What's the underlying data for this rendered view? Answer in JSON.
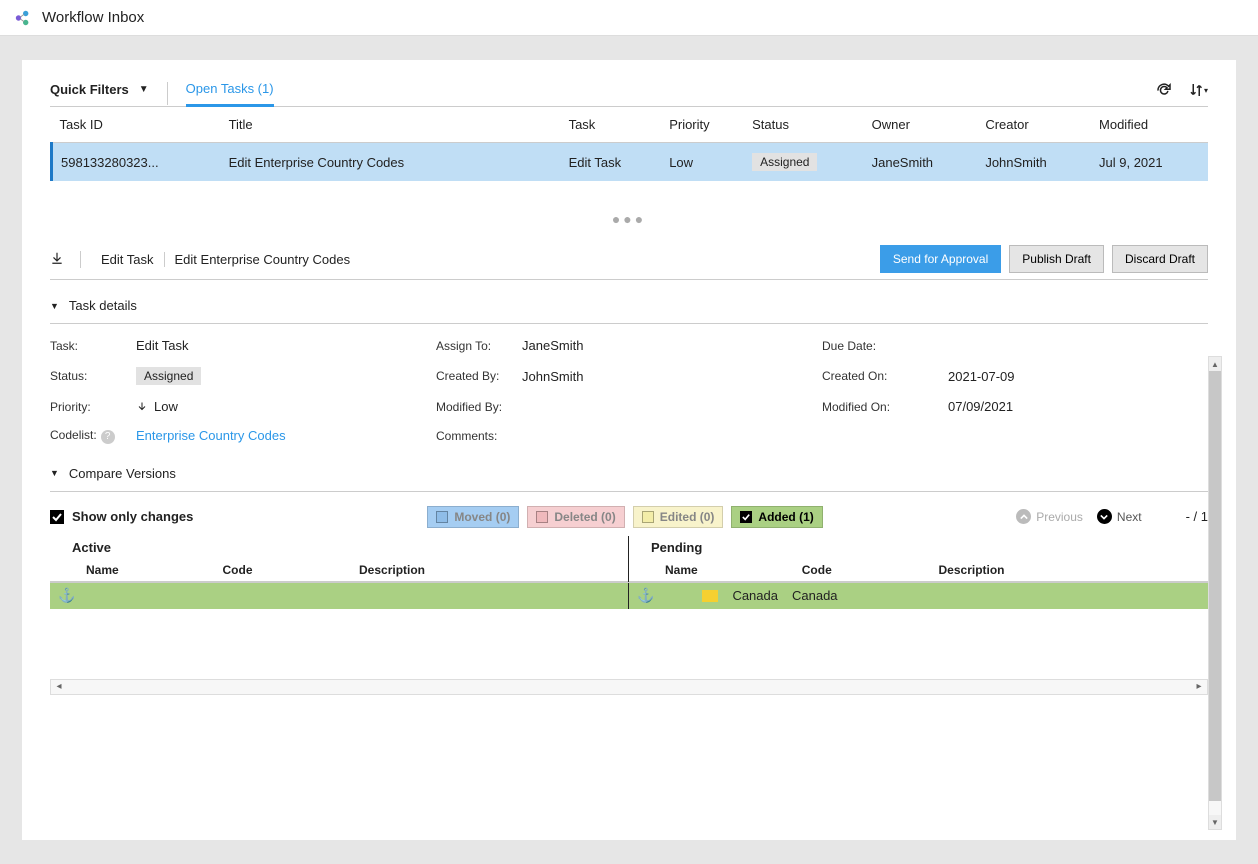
{
  "header": {
    "title": "Workflow Inbox"
  },
  "filters": {
    "quick_label": "Quick Filters",
    "open_tasks_label": "Open Tasks (1)"
  },
  "table": {
    "columns": {
      "task_id": "Task ID",
      "title": "Title",
      "task": "Task",
      "priority": "Priority",
      "status": "Status",
      "owner": "Owner",
      "creator": "Creator",
      "modified": "Modified"
    },
    "row": {
      "task_id": "598133280323...",
      "title": "Edit Enterprise Country Codes",
      "task": "Edit Task",
      "priority": "Low",
      "status": "Assigned",
      "owner": "JaneSmith",
      "creator": "JohnSmith",
      "modified": "Jul 9, 2021"
    }
  },
  "detail_header": {
    "task_type": "Edit Task",
    "task_title": "Edit Enterprise Country Codes",
    "actions": {
      "send": "Send for Approval",
      "publish": "Publish Draft",
      "discard": "Discard Draft"
    }
  },
  "sections": {
    "task_details": "Task details",
    "compare": "Compare Versions"
  },
  "details": {
    "task_k": "Task:",
    "task_v": "Edit Task",
    "status_k": "Status:",
    "status_v": "Assigned",
    "priority_k": "Priority:",
    "priority_v": "Low",
    "codelist_k": "Codelist:",
    "codelist_v": "Enterprise Country Codes",
    "assign_k": "Assign To:",
    "assign_v": "JaneSmith",
    "created_by_k": "Created By:",
    "created_by_v": "JohnSmith",
    "modified_by_k": "Modified By:",
    "modified_by_v": "",
    "comments_k": "Comments:",
    "due_k": "Due Date:",
    "due_v": "",
    "created_on_k": "Created On:",
    "created_on_v": "2021-07-09",
    "modified_on_k": "Modified On:",
    "modified_on_v": "07/09/2021"
  },
  "compare": {
    "show_changes": "Show only changes",
    "moved": "Moved (0)",
    "deleted": "Deleted (0)",
    "edited": "Edited (0)",
    "added": "Added (1)",
    "previous": "Previous",
    "next": "Next",
    "page_indicator": "- / 1",
    "active_label": "Active",
    "pending_label": "Pending",
    "col_name": "Name",
    "col_code": "Code",
    "col_desc": "Description",
    "pending_row": {
      "name": "Canada",
      "code": "Canada"
    }
  }
}
